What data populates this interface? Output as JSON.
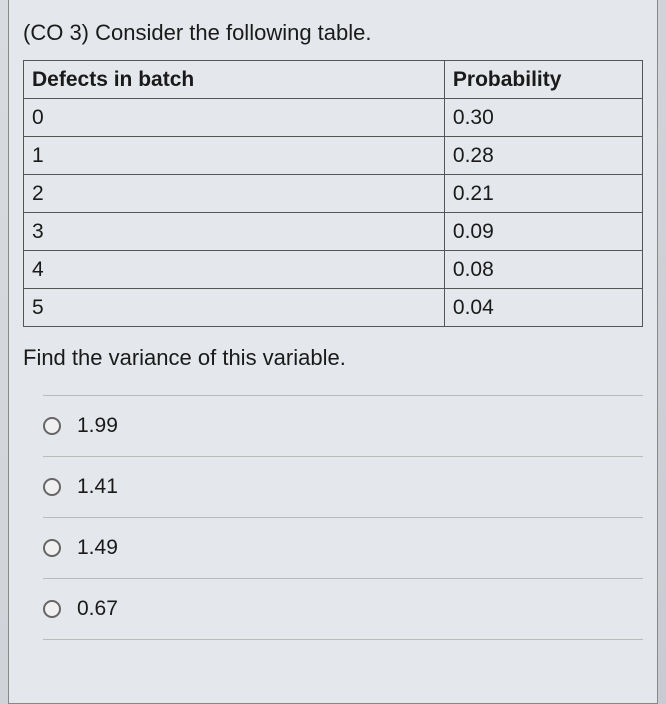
{
  "question": {
    "prompt": "(CO 3) Consider the following table.",
    "instruction": "Find the variance of this variable."
  },
  "table": {
    "headers": [
      "Defects in batch",
      "Probability"
    ],
    "rows": [
      [
        "0",
        "0.30"
      ],
      [
        "1",
        "0.28"
      ],
      [
        "2",
        "0.21"
      ],
      [
        "3",
        "0.09"
      ],
      [
        "4",
        "0.08"
      ],
      [
        "5",
        "0.04"
      ]
    ]
  },
  "options": [
    "1.99",
    "1.41",
    "1.49",
    "0.67"
  ]
}
